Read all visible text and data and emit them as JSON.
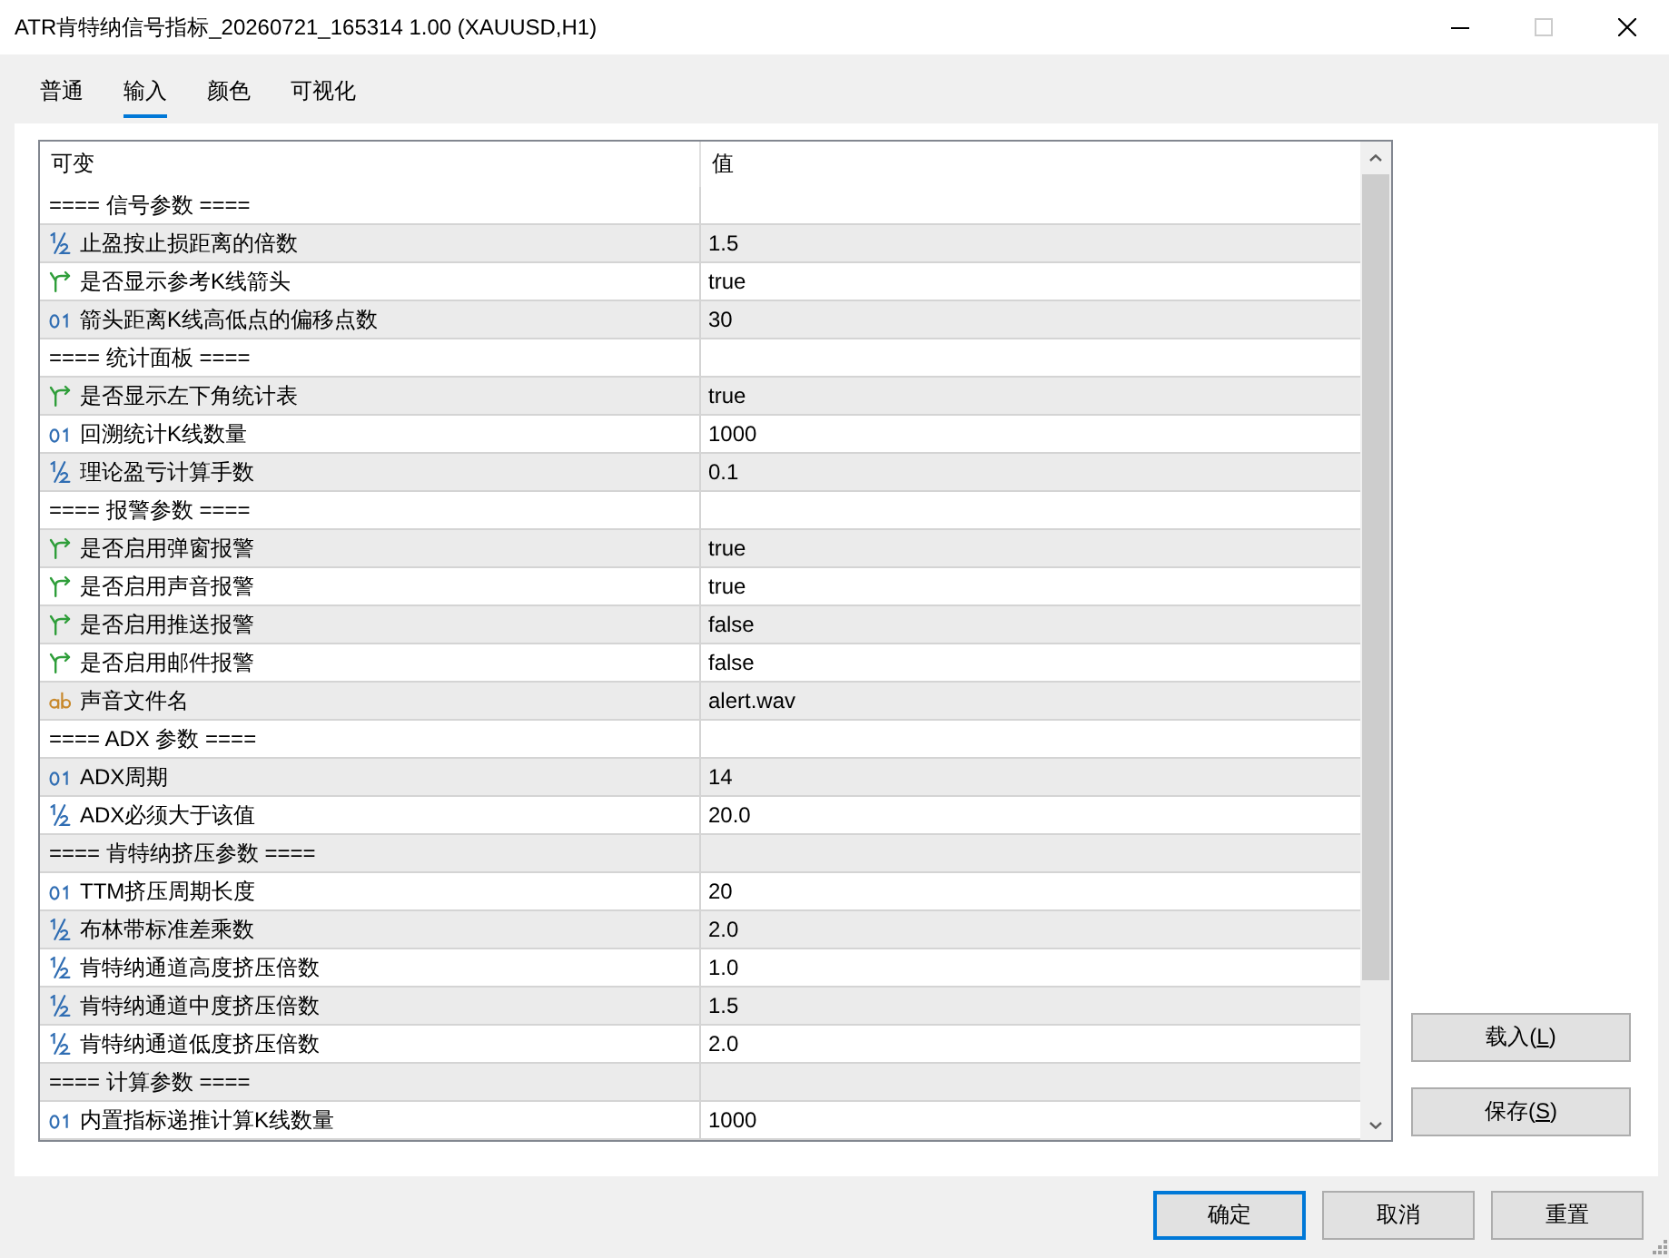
{
  "window": {
    "title": "ATR肯特纳信号指标_20260721_165314 1.00 (XAUUSD,H1)",
    "maximize_disabled": true
  },
  "tabs": [
    {
      "label": "普通",
      "selected": false
    },
    {
      "label": "输入",
      "selected": true
    },
    {
      "label": "颜色",
      "selected": false
    },
    {
      "label": "可视化",
      "selected": false
    }
  ],
  "table": {
    "columns": [
      "可变",
      "值"
    ],
    "rows": [
      {
        "kind": "group",
        "name": "==== 信号参数 ===="
      },
      {
        "kind": "double",
        "name": "止盈按止损距离的倍数",
        "value": "1.5"
      },
      {
        "kind": "bool",
        "name": "是否显示参考K线箭头",
        "value": "true"
      },
      {
        "kind": "int",
        "name": "箭头距离K线高低点的偏移点数",
        "value": "30"
      },
      {
        "kind": "group",
        "name": "==== 统计面板 ===="
      },
      {
        "kind": "bool",
        "name": "是否显示左下角统计表",
        "value": "true"
      },
      {
        "kind": "int",
        "name": "回溯统计K线数量",
        "value": "1000"
      },
      {
        "kind": "double",
        "name": "理论盈亏计算手数",
        "value": "0.1"
      },
      {
        "kind": "group",
        "name": "==== 报警参数 ===="
      },
      {
        "kind": "bool",
        "name": "是否启用弹窗报警",
        "value": "true"
      },
      {
        "kind": "bool",
        "name": "是否启用声音报警",
        "value": "true"
      },
      {
        "kind": "bool",
        "name": "是否启用推送报警",
        "value": "false"
      },
      {
        "kind": "bool",
        "name": "是否启用邮件报警",
        "value": "false"
      },
      {
        "kind": "string",
        "name": "声音文件名",
        "value": "alert.wav"
      },
      {
        "kind": "group",
        "name": "==== ADX 参数 ===="
      },
      {
        "kind": "int",
        "name": "ADX周期",
        "value": "14"
      },
      {
        "kind": "double",
        "name": "ADX必须大于该值",
        "value": "20.0"
      },
      {
        "kind": "group",
        "name": "==== 肯特纳挤压参数 ===="
      },
      {
        "kind": "int",
        "name": "TTM挤压周期长度",
        "value": "20"
      },
      {
        "kind": "double",
        "name": "布林带标准差乘数",
        "value": "2.0"
      },
      {
        "kind": "double",
        "name": "肯特纳通道高度挤压倍数",
        "value": "1.0"
      },
      {
        "kind": "double",
        "name": "肯特纳通道中度挤压倍数",
        "value": "1.5"
      },
      {
        "kind": "double",
        "name": "肯特纳通道低度挤压倍数",
        "value": "2.0"
      },
      {
        "kind": "group",
        "name": "==== 计算参数 ===="
      },
      {
        "kind": "int",
        "name": "内置指标递推计算K线数量",
        "value": "1000"
      }
    ]
  },
  "side_buttons": [
    {
      "label_before": "载入(",
      "mnemonic": "L",
      "label_after": ")"
    },
    {
      "label_before": "保存(",
      "mnemonic": "S",
      "label_after": ")"
    }
  ],
  "buttons": [
    {
      "label": "确定",
      "default": true
    },
    {
      "label": "取消",
      "default": false
    },
    {
      "label": "重置",
      "default": false
    }
  ]
}
